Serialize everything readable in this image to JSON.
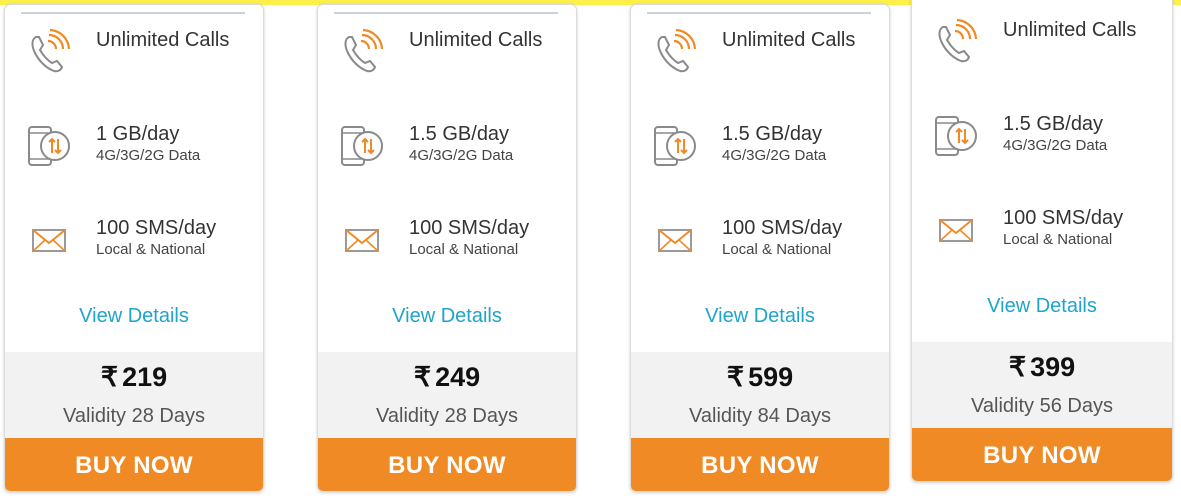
{
  "colors": {
    "accent": "#f08a24",
    "link": "#1fa4cc",
    "page_bg": "#fef04a"
  },
  "icons": {
    "calls": "phone-calls-icon",
    "data": "mobile-data-icon",
    "sms": "envelope-icon"
  },
  "plans": [
    {
      "calls": "Unlimited Calls",
      "data_main": "1 GB/day",
      "data_sub": "4G/3G/2G Data",
      "sms_main": "100 SMS/day",
      "sms_sub": "Local & National",
      "view_details": "View Details",
      "currency": "₹",
      "price": "219",
      "validity": "Validity 28 Days",
      "buy_label": "BUY NOW"
    },
    {
      "calls": "Unlimited Calls",
      "data_main": "1.5 GB/day",
      "data_sub": "4G/3G/2G Data",
      "sms_main": "100 SMS/day",
      "sms_sub": "Local & National",
      "view_details": "View Details",
      "currency": "₹",
      "price": "249",
      "validity": "Validity 28 Days",
      "buy_label": "BUY NOW"
    },
    {
      "calls": "Unlimited Calls",
      "data_main": "1.5 GB/day",
      "data_sub": "4G/3G/2G Data",
      "sms_main": "100 SMS/day",
      "sms_sub": "Local & National",
      "view_details": "View Details",
      "currency": "₹",
      "price": "599",
      "validity": "Validity 84 Days",
      "buy_label": "BUY NOW"
    },
    {
      "calls": "Unlimited Calls",
      "data_main": "1.5 GB/day",
      "data_sub": "4G/3G/2G Data",
      "sms_main": "100 SMS/day",
      "sms_sub": "Local & National",
      "view_details": "View Details",
      "currency": "₹",
      "price": "399",
      "validity": "Validity 56 Days",
      "buy_label": "BUY NOW"
    }
  ]
}
